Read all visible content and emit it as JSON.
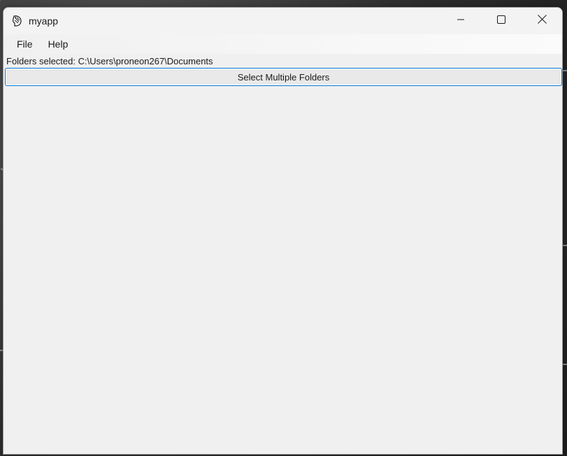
{
  "window": {
    "title": "myapp",
    "icon": "feather-icon",
    "controls": {
      "minimize": "minimize-icon",
      "maximize": "maximize-icon",
      "close": "close-icon"
    }
  },
  "menu": {
    "items": [
      {
        "label": "File"
      },
      {
        "label": "Help"
      }
    ]
  },
  "main": {
    "folders_label": "Folders selected: C:\\Users\\proneon267\\Documents",
    "select_button_label": "Select Multiple Folders"
  },
  "colors": {
    "accent": "#0078d4",
    "window_bg": "#f0f0f0"
  }
}
